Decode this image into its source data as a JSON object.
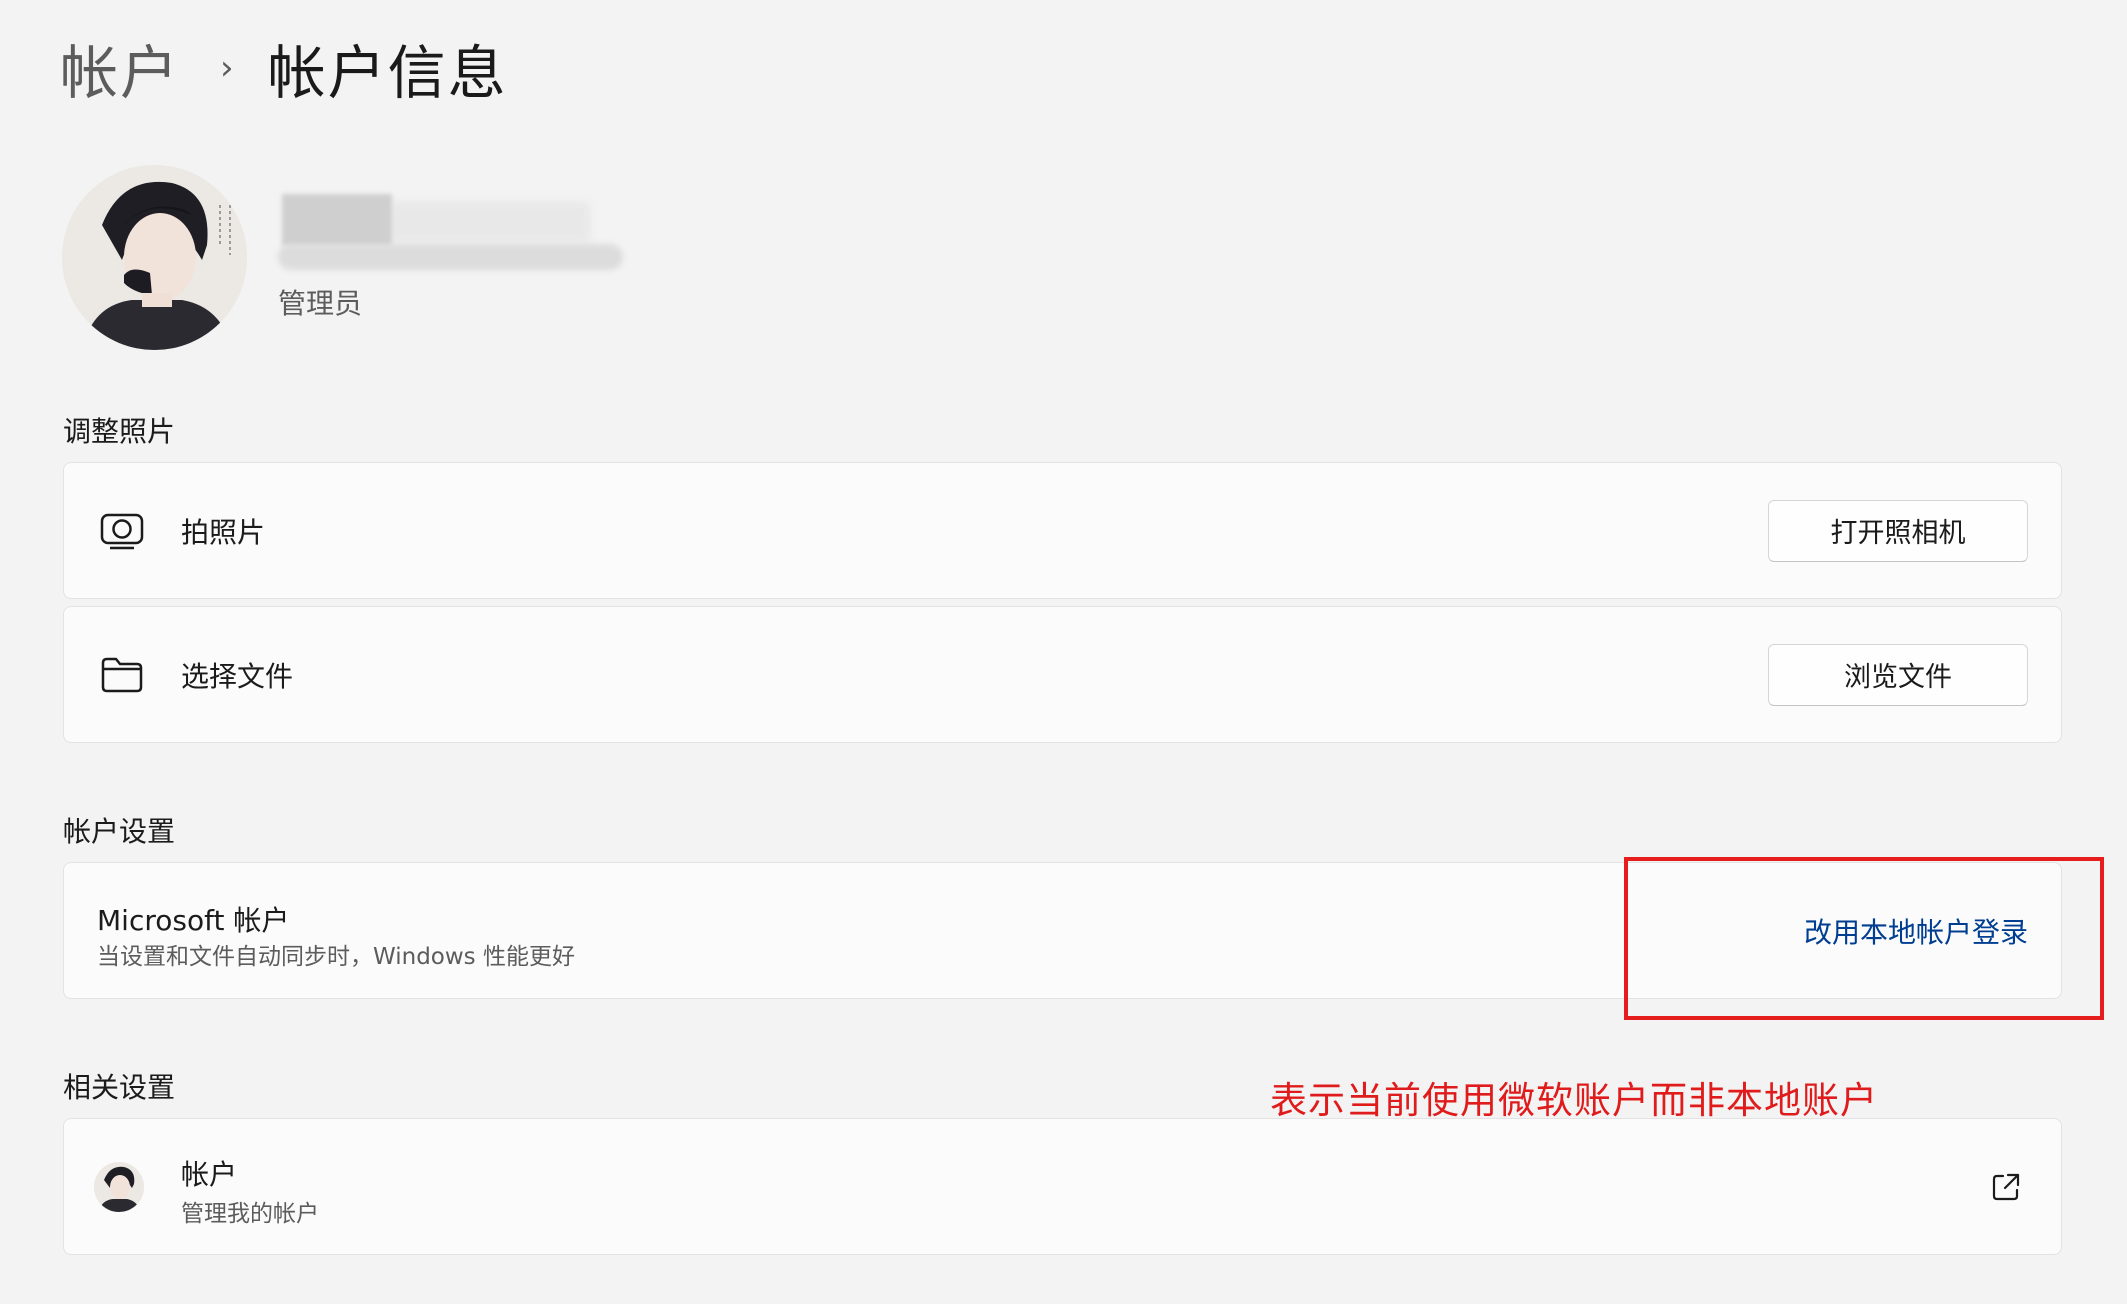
{
  "breadcrumb": {
    "parent": "帐户",
    "separator": "›",
    "current": "帐户信息"
  },
  "profile": {
    "avatar": "profile-photo",
    "name_redacted": true,
    "role": "管理员"
  },
  "adjust_photo": {
    "title": "调整照片",
    "items": [
      {
        "icon": "camera-icon",
        "label": "拍照片",
        "button": "打开照相机"
      },
      {
        "icon": "folder-icon",
        "label": "选择文件",
        "button": "浏览文件"
      }
    ]
  },
  "account_settings": {
    "title": "帐户设置",
    "microsoft_account": {
      "title": "Microsoft 帐户",
      "subtitle": "当设置和文件自动同步时，Windows 性能更好",
      "link": "改用本地帐户登录"
    }
  },
  "annotation": {
    "text": "表示当前使用微软账户而非本地账户",
    "color": "#e01b1b"
  },
  "related_settings": {
    "title": "相关设置",
    "account": {
      "title": "帐户",
      "subtitle": "管理我的帐户",
      "icon": "external-link-icon"
    }
  },
  "colors": {
    "background": "#f3f3f3",
    "card": "#fbfbfb",
    "link": "#003e92",
    "highlight": "#e51d1d"
  }
}
